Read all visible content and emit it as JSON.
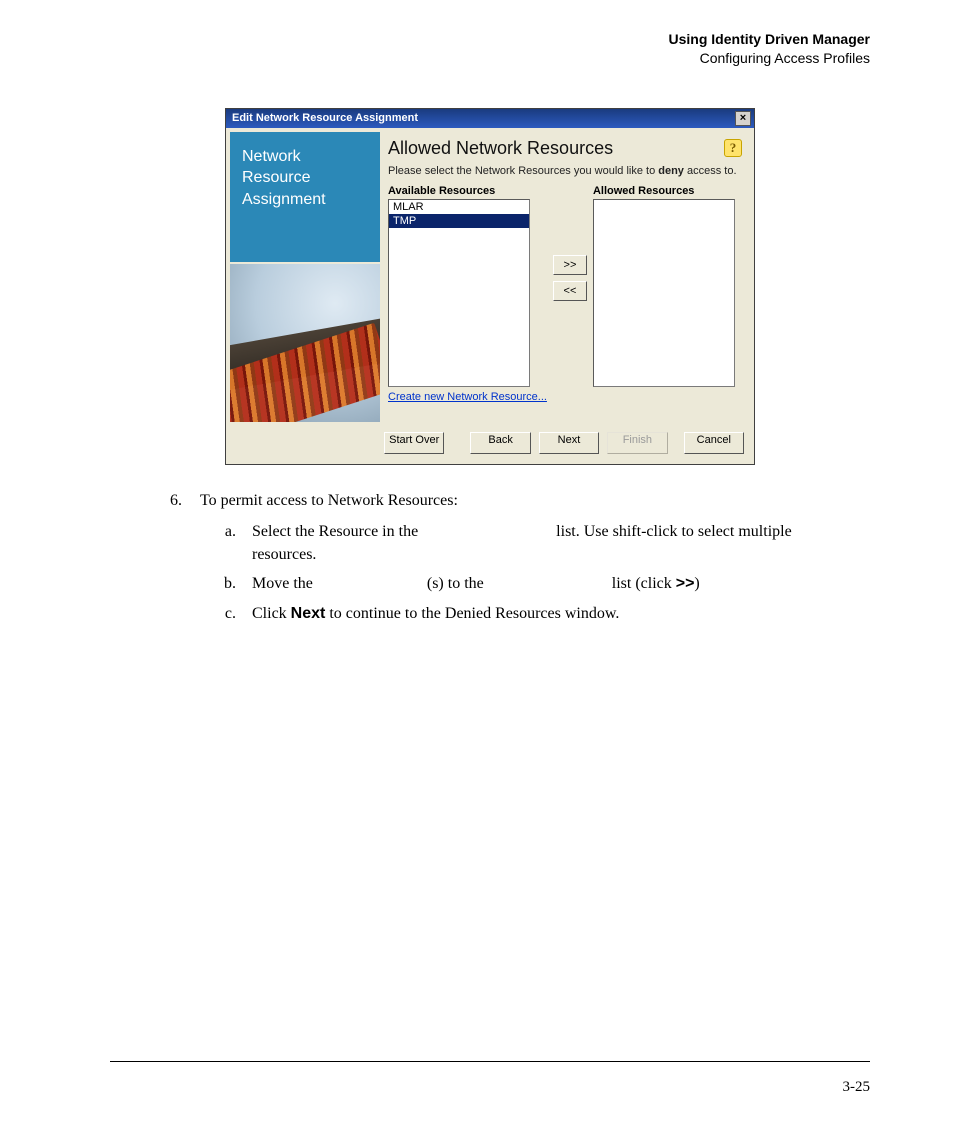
{
  "runningHead": {
    "title": "Using Identity Driven Manager",
    "subtitle": "Configuring Access Profiles"
  },
  "dialog": {
    "title": "Edit Network Resource Assignment",
    "close": "×",
    "sidebarText": "Network\nResource\nAssignment",
    "heading": "Allowed Network Resources",
    "help": "?",
    "instructionPrefix": "Please select the Network Resources you would like to ",
    "instructionBold": "deny",
    "instructionSuffix": " access to.",
    "availableLabel": "Available Resources",
    "allowedLabel": "Allowed Resources",
    "availableItems": [
      "MLAR",
      "TMP"
    ],
    "selectedIndex": 1,
    "moveRight": ">>",
    "moveLeft": "<<",
    "createLink": "Create new Network Resource...",
    "buttons": {
      "startOver": "Start Over",
      "back": "Back",
      "next": "Next",
      "finish": "Finish",
      "cancel": "Cancel"
    }
  },
  "steps": {
    "num": "6.",
    "lead": "To permit access to Network Resources:",
    "a": {
      "let": "a.",
      "t1": "Select the Resource in the ",
      "t2": " list. Use shift-click to select multiple resources."
    },
    "b": {
      "let": "b.",
      "t1": "Move the ",
      "t2": "(s) to the ",
      "t3": " list (click  ",
      "bold": ">>",
      "t4": ")"
    },
    "c": {
      "let": "c.",
      "t1": "Click ",
      "bold": "Next",
      "t2": " to continue to the Denied Resources window."
    }
  },
  "pageNumber": "3-25"
}
